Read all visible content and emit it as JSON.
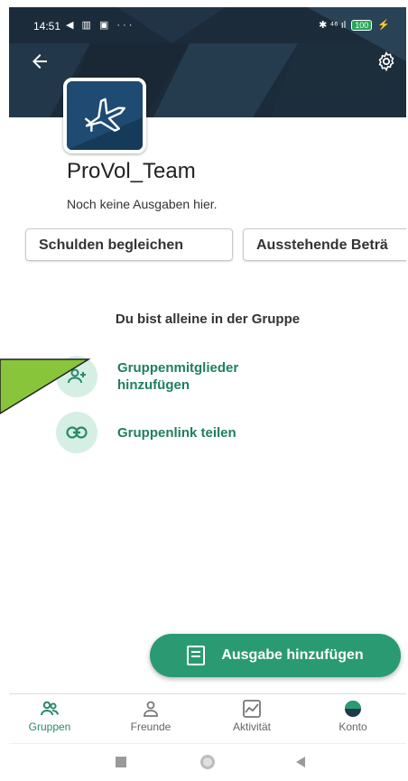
{
  "status_bar": {
    "time": "14:51",
    "left_icons": "◀ ▥ ▣ ···",
    "right_icons": "✱ ⁴⁶ ıl",
    "battery": "100"
  },
  "group": {
    "name": "ProVol_Team",
    "subtitle": "Noch keine Ausgaben hier."
  },
  "buttons": {
    "settle_debts": "Schulden begleichen",
    "outstanding": "Ausstehende Beträ"
  },
  "empty_state": {
    "alone_text": "Du bist alleine in der Gruppe",
    "add_members": "Gruppenmitglieder hinzufügen",
    "share_link": "Gruppenlink teilen"
  },
  "fab": {
    "label": "Ausgabe hinzufügen"
  },
  "bottom_nav": {
    "items": [
      {
        "label": "Gruppen",
        "icon": "group-icon",
        "active": true
      },
      {
        "label": "Freunde",
        "icon": "person-icon",
        "active": false
      },
      {
        "label": "Aktivität",
        "icon": "activity-icon",
        "active": false
      },
      {
        "label": "Konto",
        "icon": "account-icon",
        "active": false
      }
    ]
  },
  "colors": {
    "accent": "#2a9a72",
    "accent_text": "#1e7f62",
    "header_bg": "#1e3040",
    "annotation_pointer": "#88c53a"
  }
}
